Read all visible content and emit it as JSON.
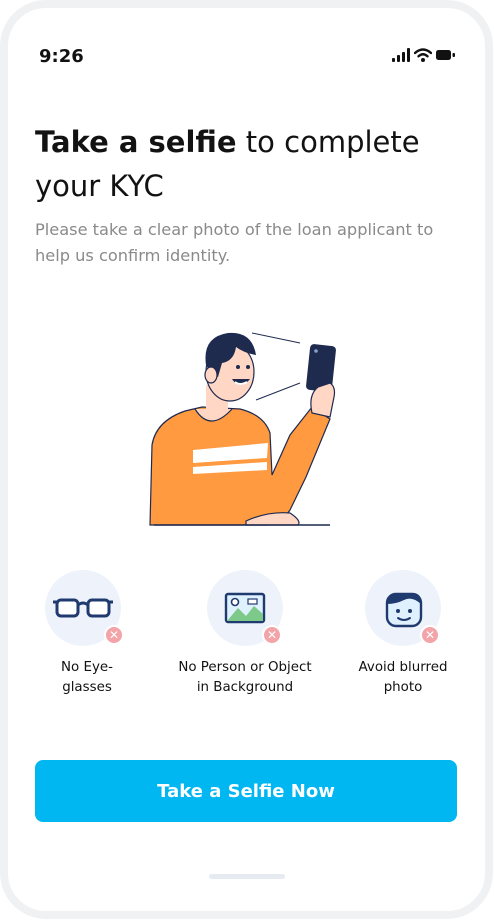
{
  "status_bar": {
    "time": "9:26",
    "icons": [
      "cellular-signal-icon",
      "wifi-icon",
      "battery-icon"
    ]
  },
  "header": {
    "title_bold": "Take a selfie",
    "title_rest": " to complete your KYC",
    "subtitle": "Please take a clear photo of the loan applicant to help us confirm identity."
  },
  "illustration": {
    "name": "person-taking-selfie-illustration",
    "colors": {
      "shirt": "#ff9a40",
      "skin": "#ffd7c4",
      "hair": "#1f2a4f",
      "phone": "#1f2a4f"
    }
  },
  "tips": [
    {
      "icon": "eyeglasses-icon",
      "badge": "cross-icon",
      "label": "No Eye-glasses",
      "label_line1": "No Eye-",
      "label_line2": "glasses"
    },
    {
      "icon": "background-image-icon",
      "badge": "cross-icon",
      "label": "No Person or Object in Background",
      "label_line1": "No Person or Object",
      "label_line2": "in Background"
    },
    {
      "icon": "face-icon",
      "badge": "cross-icon",
      "label": "Avoid blurred photo",
      "label_line1": "Avoid blurred",
      "label_line2": "photo"
    }
  ],
  "actions": {
    "primary_label": "Take a Selfie Now"
  },
  "colors": {
    "accent": "#00b7f1",
    "tip_circle": "#eef3fb",
    "cross_badge": "#f3a4a8",
    "text_primary": "#121212",
    "text_secondary": "#8a8a8a"
  }
}
